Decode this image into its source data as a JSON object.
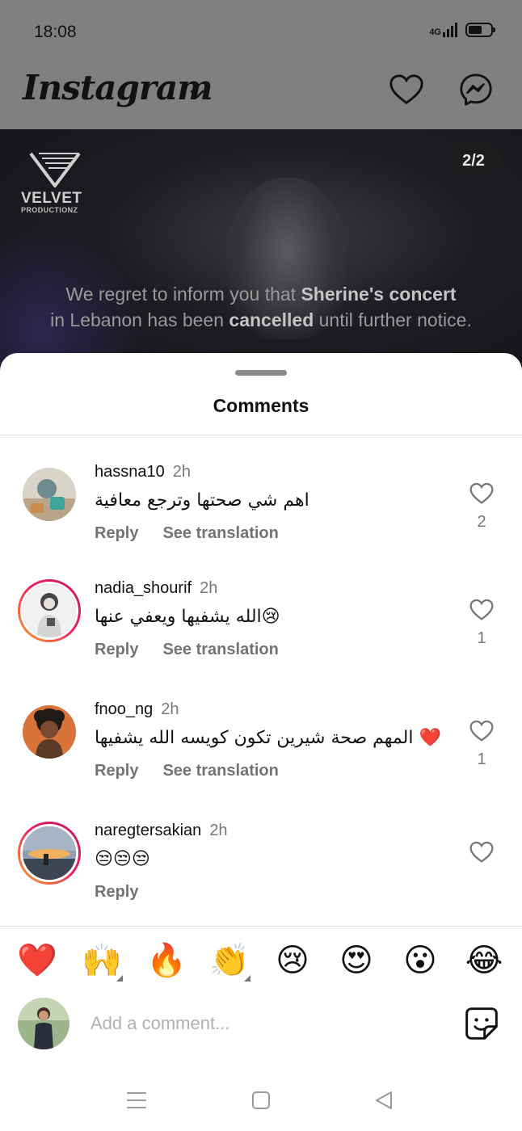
{
  "status_bar": {
    "time": "18:08",
    "network": "4G"
  },
  "header": {
    "title": "Instagram"
  },
  "post": {
    "brand_name": "VELVET",
    "brand_sub": "PRODUCTIONZ",
    "counter": "2/2",
    "caption": {
      "line1_a": "We regret to inform you that ",
      "line1_b": "Sherine's concert",
      "line2_a": "in Lebanon has been ",
      "line2_b": "cancelled",
      "line2_c": " until further notice."
    }
  },
  "sheet": {
    "title": "Comments"
  },
  "comments": [
    {
      "username": "hassna10",
      "time": "2h",
      "text": "اهم شي صحتها وترجع معافية",
      "reply": "Reply",
      "translate": "See translation",
      "likes": "2"
    },
    {
      "username": "nadia_shourif",
      "time": "2h",
      "text": "الله يشفيها ويعفي عنها😢",
      "reply": "Reply",
      "translate": "See translation",
      "likes": "1"
    },
    {
      "username": "fnoo_ng",
      "time": "2h",
      "text": "المهم صحة شيرين تكون كويسه الله يشفيها ❤️",
      "reply": "Reply",
      "translate": "See translation",
      "likes": "1"
    },
    {
      "username": "naregtersakian",
      "time": "2h",
      "text": "😒😒😒",
      "reply": "Reply",
      "translate": "",
      "likes": ""
    }
  ],
  "quick_reactions": [
    "❤️",
    "🙌",
    "🔥",
    "👏",
    "😢",
    "😍",
    "😮",
    "😂"
  ],
  "composer": {
    "placeholder": "Add a comment..."
  },
  "colors": {
    "ring_start": "#f9a825",
    "ring_end": "#c2185b",
    "like_red": "#e0245e"
  }
}
